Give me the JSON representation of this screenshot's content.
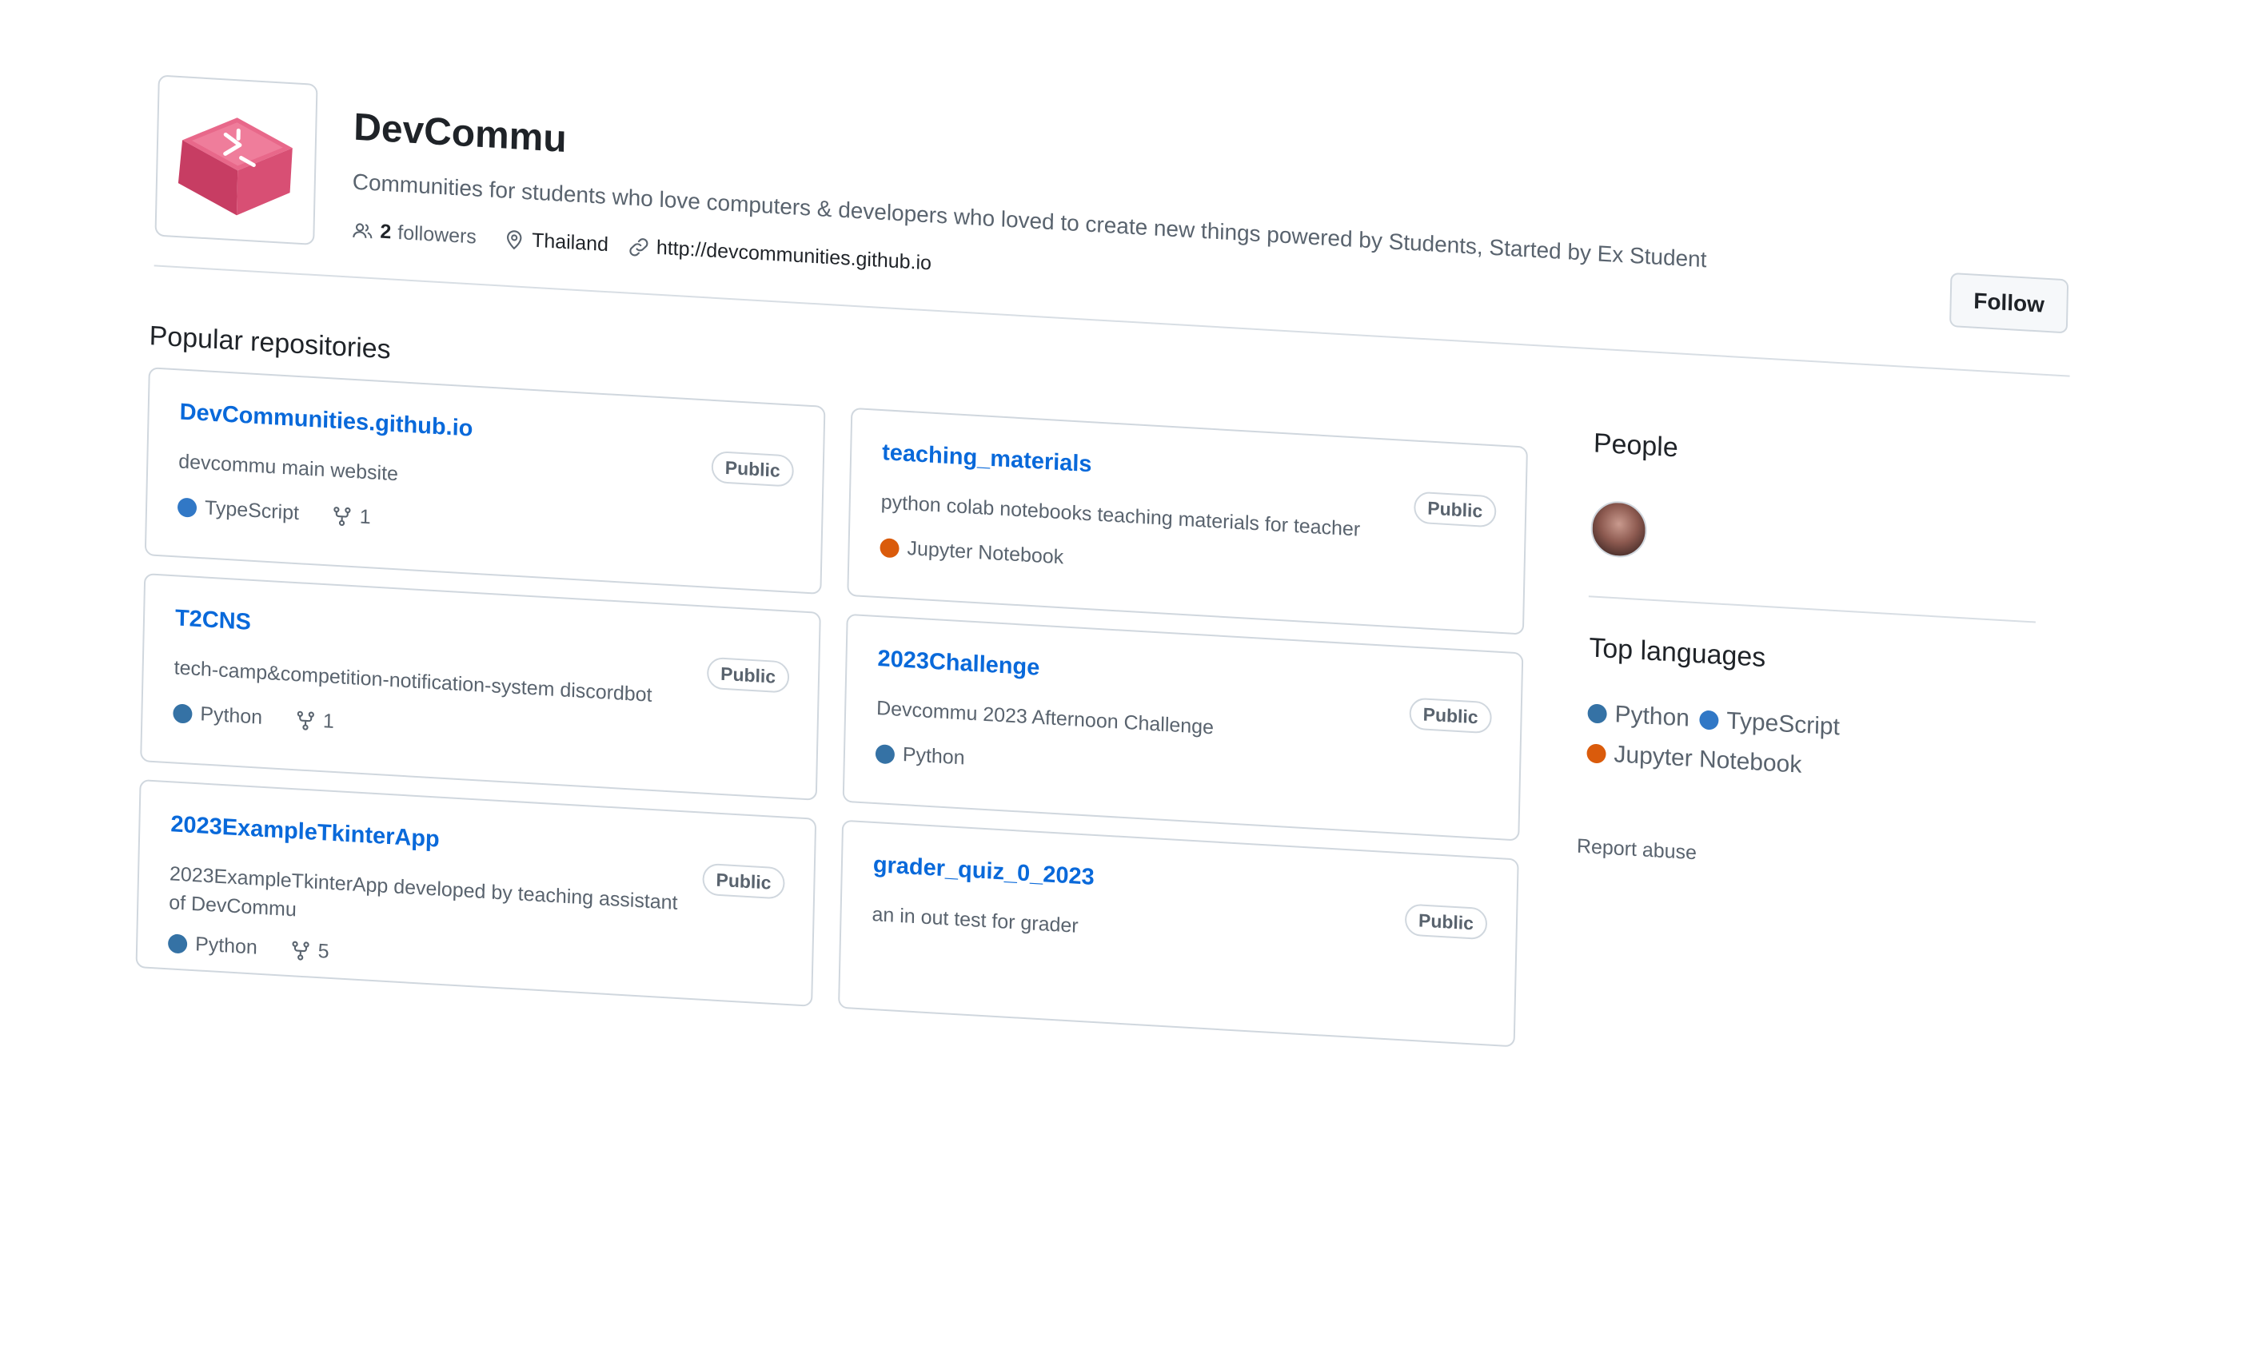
{
  "org": {
    "name": "DevCommu",
    "description": "Communities for students who love computers & developers who loved to create new things powered by Students, Started by Ex Student",
    "followers_count": "2",
    "followers_label": "followers",
    "location": "Thailand",
    "website": "http://devcommunities.github.io",
    "follow_label": "Follow"
  },
  "popular": {
    "heading": "Popular repositories",
    "repos": [
      {
        "name": "DevCommunities.github.io",
        "visibility": "Public",
        "description": "devcommu main website",
        "language": "TypeScript",
        "language_color": "#3178c6",
        "forks": "1"
      },
      {
        "name": "teaching_materials",
        "visibility": "Public",
        "description": "python colab notebooks teaching materials for teacher",
        "language": "Jupyter Notebook",
        "language_color": "#da5b0b",
        "forks": ""
      },
      {
        "name": "T2CNS",
        "visibility": "Public",
        "description": "tech-camp&competition-notification-system discordbot",
        "language": "Python",
        "language_color": "#3572a5",
        "forks": "1"
      },
      {
        "name": "2023Challenge",
        "visibility": "Public",
        "description": "Devcommu 2023 Afternoon Challenge",
        "language": "Python",
        "language_color": "#3572a5",
        "forks": ""
      },
      {
        "name": "2023ExampleTkinterApp",
        "visibility": "Public",
        "description": "2023ExampleTkinterApp developed by teaching assistant of DevCommu",
        "language": "Python",
        "language_color": "#3572a5",
        "forks": "5"
      },
      {
        "name": "grader_quiz_0_2023",
        "visibility": "Public",
        "description": "an in out test for grader",
        "language": "",
        "language_color": "",
        "forks": ""
      }
    ]
  },
  "sidebar": {
    "people_heading": "People",
    "top_languages_heading": "Top languages",
    "languages": [
      {
        "name": "Python",
        "color": "#3572a5"
      },
      {
        "name": "TypeScript",
        "color": "#3178c6"
      },
      {
        "name": "Jupyter Notebook",
        "color": "#da5b0b"
      }
    ],
    "report_abuse": "Report abuse"
  }
}
